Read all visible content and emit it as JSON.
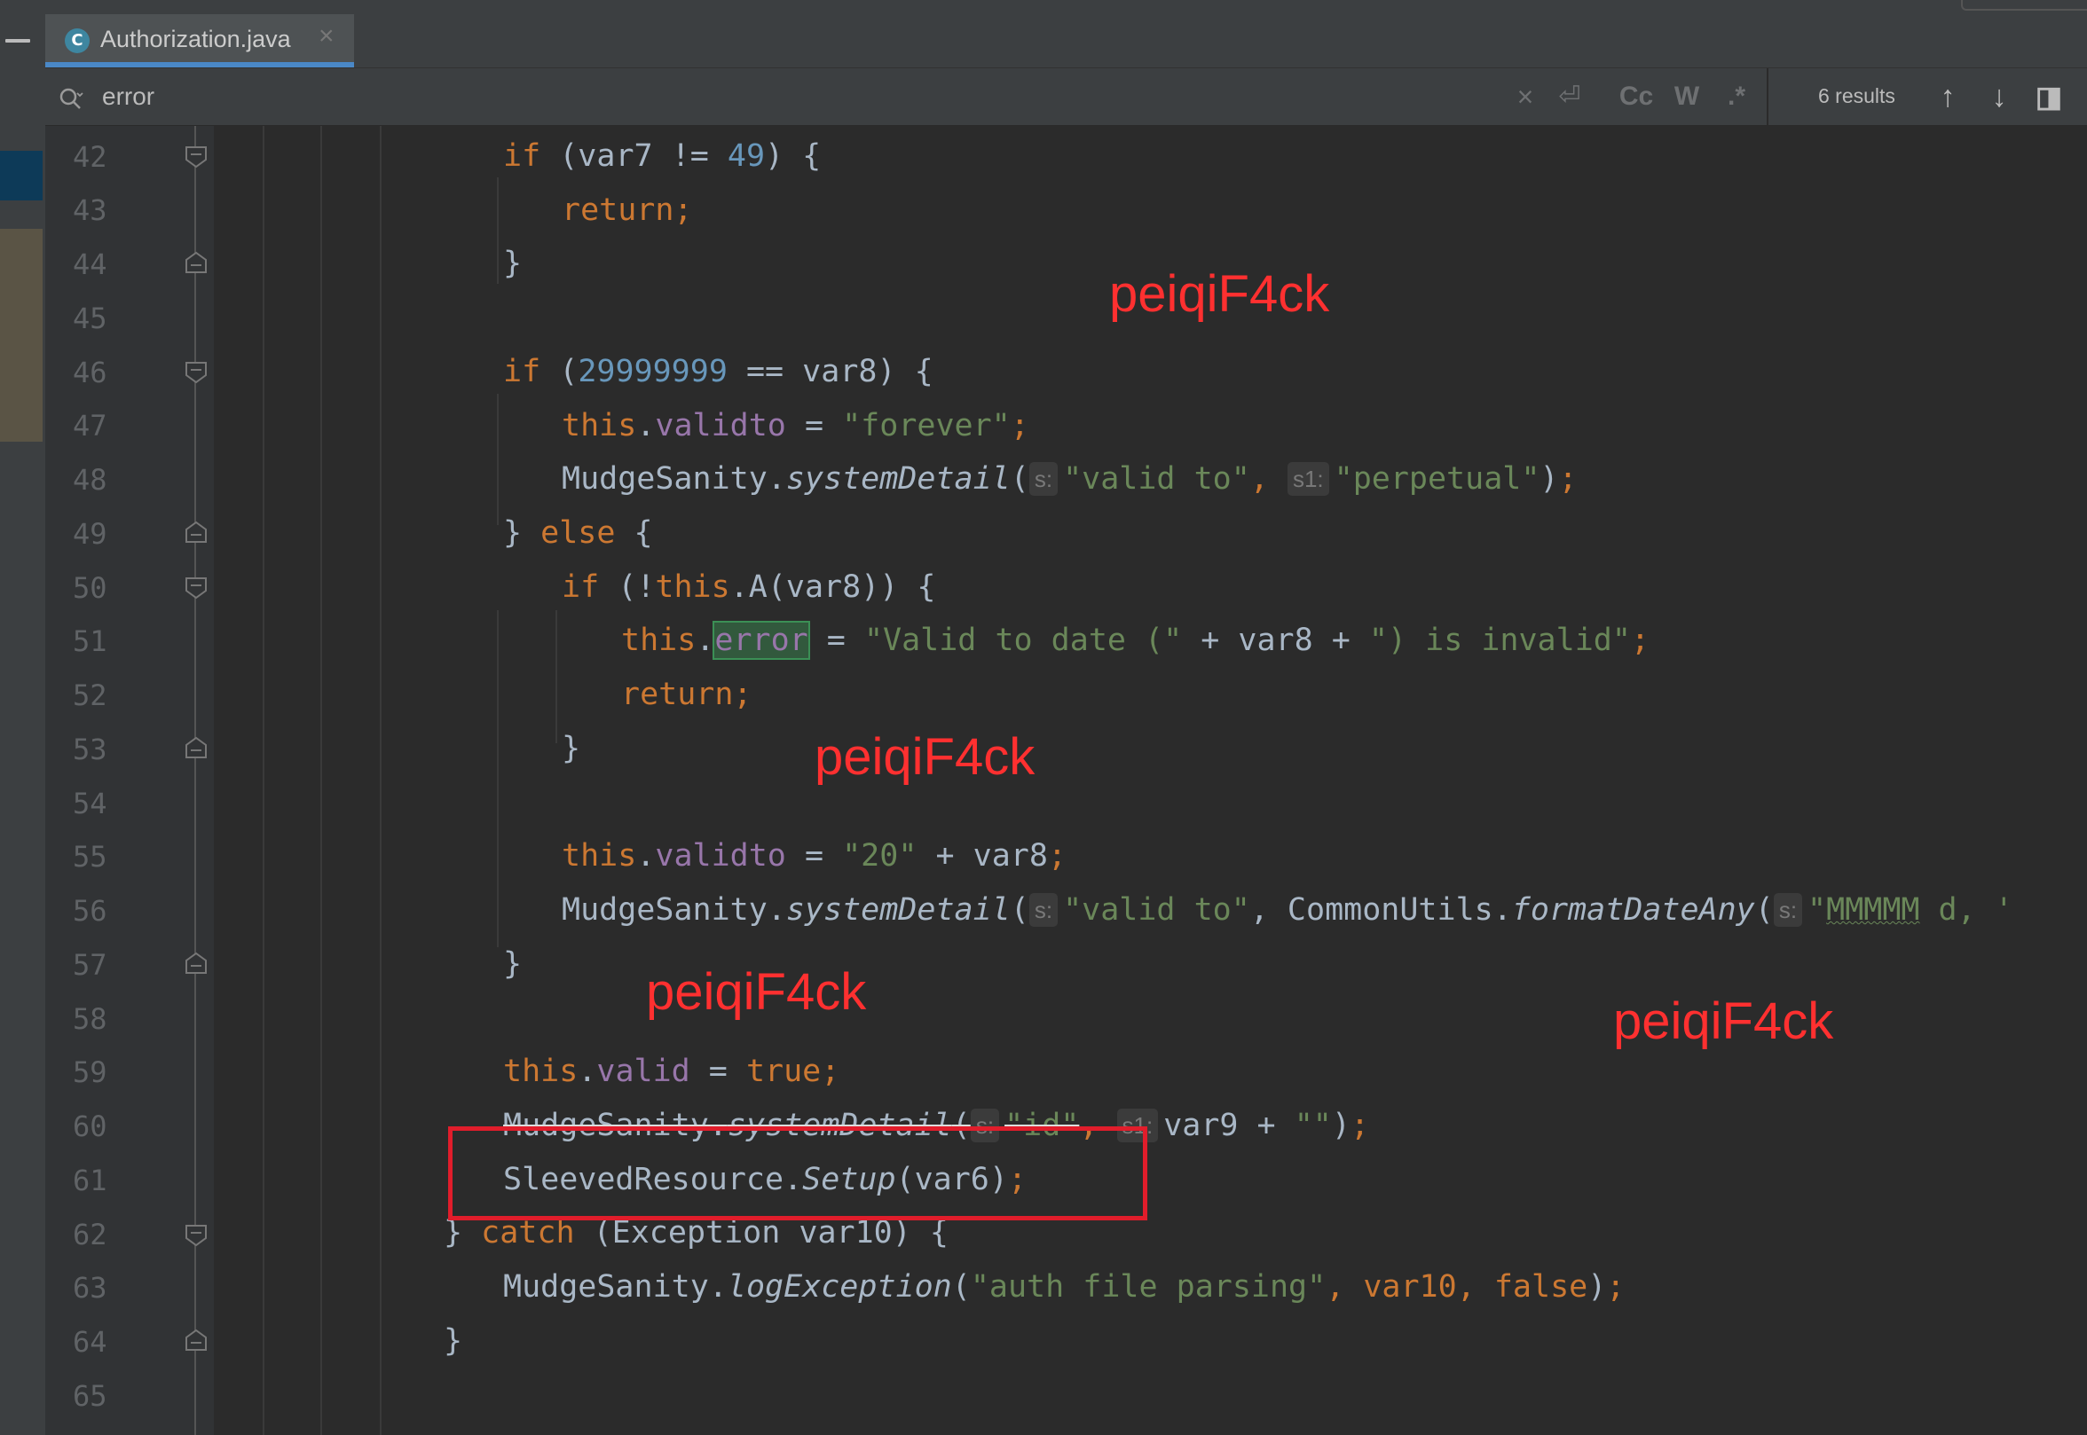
{
  "tab": {
    "title": "Authorization.java",
    "close": "×",
    "icon_letter": "C",
    "icon": "java-class-icon"
  },
  "search": {
    "query": "error",
    "results": "6 results",
    "cc": "Cc",
    "w": "W",
    "regex": ".*",
    "clear": "×",
    "wrap": "⏎",
    "up": "↑",
    "down": "↓",
    "filter": "◨"
  },
  "colors": {
    "keyword": "#cc7832",
    "number": "#6897bb",
    "string": "#6a8759",
    "field": "#9876aa",
    "text": "#a9b7c6",
    "watermark": "#ff3030",
    "highlight_box": "#e11d2b"
  },
  "lines": {
    "l42": {
      "no": "42",
      "kw": "if",
      "t1": " (var7 != ",
      "num": "49",
      "t2": ") {"
    },
    "l43": {
      "no": "43",
      "kw": "return;"
    },
    "l44": {
      "no": "44",
      "t": "}"
    },
    "l45": {
      "no": "45"
    },
    "l46": {
      "no": "46",
      "kw": "if",
      "t1": " (",
      "num": "29999999",
      "t2": " == var8) {"
    },
    "l47": {
      "no": "47",
      "kw": "this",
      "t1": ".",
      "fld": "validto",
      "t2": " = ",
      "str": "\"forever\"",
      "kw2": ";"
    },
    "l48": {
      "no": "48",
      "t1": "MudgeSanity.",
      "mth": "systemDetail",
      "t2": "(",
      "h1": "s:",
      "s1": "\"valid to\"",
      "c1": ", ",
      "h2": "s1:",
      "s2": "\"perpetual\"",
      "t3": ")",
      "kw2": ";"
    },
    "l49": {
      "no": "49",
      "t1": "} ",
      "kw": "else",
      "t2": " {"
    },
    "l50": {
      "no": "50",
      "kw": "if",
      "t1": " (!",
      "kw2": "this",
      "t2": ".A(var8)) {"
    },
    "l51": {
      "no": "51",
      "kw": "this",
      "t1": ".",
      "match": "error",
      "t2": " = ",
      "s1": "\"Valid to date (\"",
      "t3": " + var8 + ",
      "s2": "\") is invalid\"",
      "kw2": ";"
    },
    "l52": {
      "no": "52",
      "kw": "return;"
    },
    "l53": {
      "no": "53",
      "t": "}"
    },
    "l54": {
      "no": "54"
    },
    "l55": {
      "no": "55",
      "kw": "this",
      "t1": ".",
      "fld": "validto",
      "t2": " = ",
      "str": "\"20\"",
      "t3": " + var8",
      "kw2": ";"
    },
    "l56": {
      "no": "56",
      "t1": "MudgeSanity.",
      "mth": "systemDetail",
      "t2": "(",
      "h1": "s:",
      "s1": "\"valid to\"",
      "c1": ", CommonUtils.",
      "mth2": "formatDateAny",
      "t3": "(",
      "h2": "s:",
      "s2a": "\"",
      "s2b": "MMMMM",
      "s2c": " d, '"
    },
    "l57": {
      "no": "57",
      "t": "}"
    },
    "l58": {
      "no": "58"
    },
    "l59": {
      "no": "59",
      "kw": "this",
      "t1": ".",
      "fld": "valid",
      "t2": " = ",
      "kw2": "true;"
    },
    "l60": {
      "no": "60",
      "t1": "MudgeSanity.",
      "mth": "systemDetail",
      "t2": "(",
      "h1": "s:",
      "s1": "\"id\"",
      "c1": ", ",
      "h2": "s1:",
      "t3": "var9 + ",
      "s2": "\"\"",
      "t4": ")",
      "kw2": ";"
    },
    "l61": {
      "no": "61",
      "t1": "SleevedResource.",
      "mth": "Setup",
      "t2": "(var6)",
      "kw2": ";"
    },
    "l62": {
      "no": "62",
      "t1": "} ",
      "kw": "catch",
      "t2": " (Exception var10) {"
    },
    "l63": {
      "no": "63",
      "t1": "MudgeSanity.",
      "mth": "logException",
      "t2": "(",
      "s1": "\"auth file parsing\"",
      "c1": ", var10, ",
      "kw": "false",
      "t3": ")",
      "kw2": ";"
    },
    "l64": {
      "no": "64",
      "t": "}"
    },
    "l65": {
      "no": "65"
    }
  },
  "watermarks": {
    "w1": "peiqiF4ck",
    "w2": "peiqiF4ck",
    "w3": "peiqiF4ck",
    "w4": "peiqiF4ck"
  }
}
